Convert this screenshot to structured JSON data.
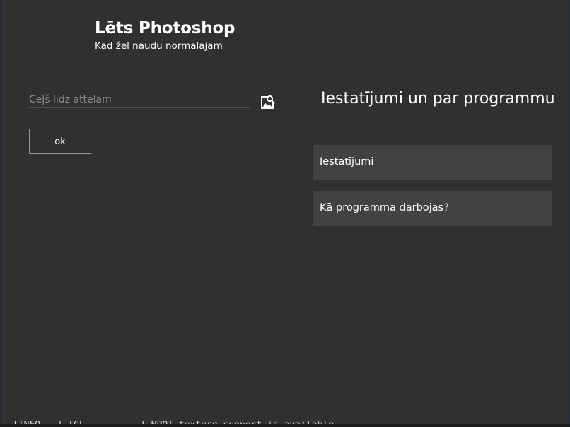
{
  "app": {
    "title": "Lēts Photoshop",
    "subtitle": "Kad žēl naudu normālajam"
  },
  "input_panel": {
    "path_placeholder": "Ceļš līdz attēlam",
    "path_value": "",
    "image_search_icon": "image-search-icon",
    "ok_label": "ok"
  },
  "settings_panel": {
    "heading": "Iestatījumi un par programmu",
    "items": [
      {
        "label": "Iestatījumi"
      },
      {
        "label": "Kā programma darbojas?"
      }
    ]
  },
  "console": {
    "line": "[INFO   ] [GL          ] NPOT texture support is available"
  },
  "colors": {
    "background": "#303030",
    "menu_item_bg": "#424242",
    "button_border": "#9a9a9a",
    "placeholder": "#8a8a8a"
  }
}
